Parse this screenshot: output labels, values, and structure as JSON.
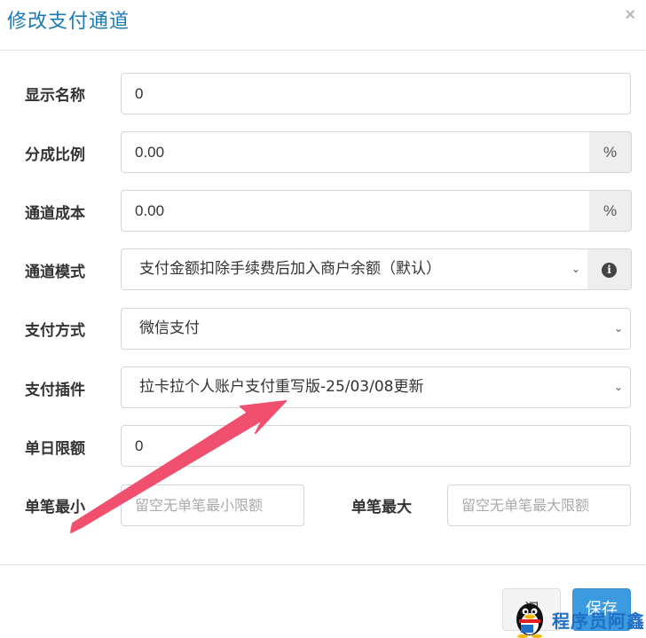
{
  "modal": {
    "title": "修改支付通道",
    "close_icon": "×"
  },
  "form": {
    "display_name": {
      "label": "显示名称",
      "value": "0"
    },
    "split_ratio": {
      "label": "分成比例",
      "value": "0.00",
      "addon": "%"
    },
    "channel_cost": {
      "label": "通道成本",
      "value": "0.00",
      "addon": "%"
    },
    "channel_mode": {
      "label": "通道模式",
      "value": "支付金额扣除手续费后加入商户余额（默认）",
      "info_icon": "i"
    },
    "pay_method": {
      "label": "支付方式",
      "value": "微信支付"
    },
    "pay_plugin": {
      "label": "支付插件",
      "value": "拉卡拉个人账户支付重写版-25/03/08更新"
    },
    "daily_limit": {
      "label": "单日限额",
      "value": "0"
    },
    "single_min": {
      "label": "单笔最小",
      "placeholder": "留空无单笔最小限额"
    },
    "single_max": {
      "label": "单笔最大",
      "placeholder": "留空无单笔最大限额"
    }
  },
  "footer": {
    "close_label": "闭",
    "save_label": "保存"
  },
  "watermark": {
    "text": "程序员阿鑫"
  },
  "colors": {
    "title": "#1b7bb5",
    "primary": "#3c9be0",
    "arrow": "#f0506e"
  },
  "icons": {
    "chevron": "chevron-down-icon",
    "info": "info-circle-icon",
    "arrow": "red-pointer-arrow",
    "mascot": "penguin-icon"
  }
}
